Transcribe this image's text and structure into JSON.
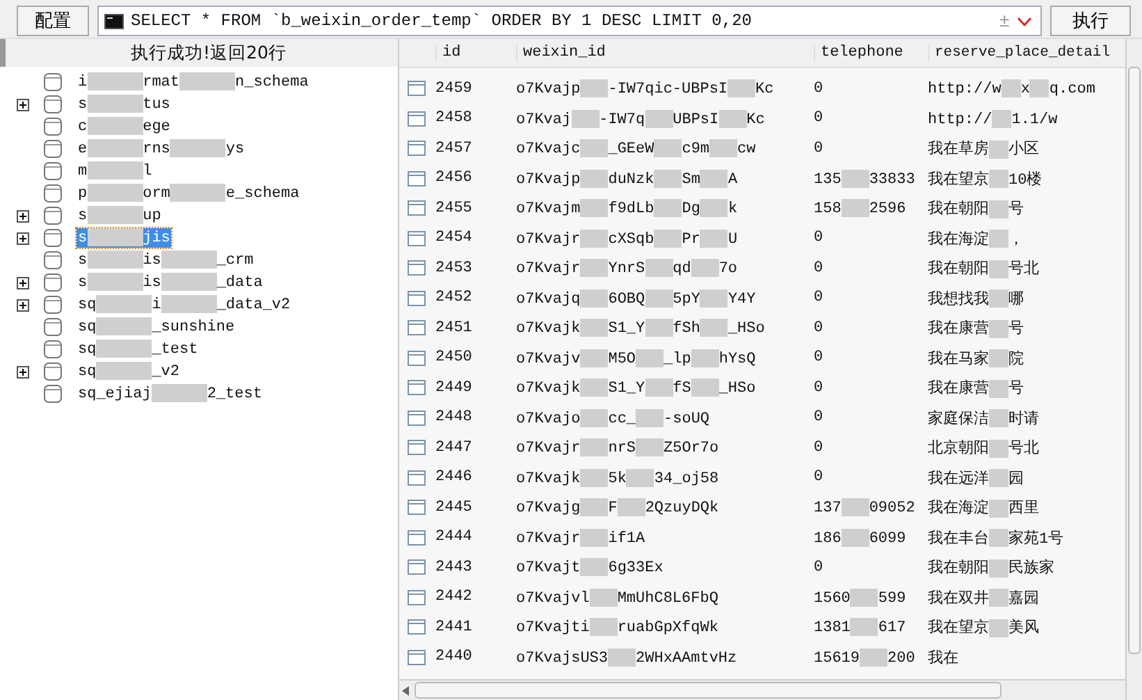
{
  "toolbar": {
    "config_button": "配置",
    "query": "SELECT * FROM `b_weixin_order_temp` ORDER BY 1 DESC LIMIT 0,20",
    "history_toggle": "±",
    "run_button": "执行"
  },
  "status": "执行成功!返回20行",
  "tree": [
    {
      "parts": [
        "i",
        "rmat",
        "n_schema"
      ],
      "expandable": false,
      "selected": false
    },
    {
      "parts": [
        "s",
        "tus"
      ],
      "expandable": true,
      "selected": false
    },
    {
      "parts": [
        "c",
        "ege"
      ],
      "expandable": false,
      "selected": false
    },
    {
      "parts": [
        "e",
        "rns",
        "ys"
      ],
      "expandable": false,
      "selected": false
    },
    {
      "parts": [
        "m",
        "l"
      ],
      "expandable": false,
      "selected": false
    },
    {
      "parts": [
        "p",
        "orm",
        "e_schema"
      ],
      "expandable": false,
      "selected": false
    },
    {
      "parts": [
        "s",
        "up"
      ],
      "expandable": true,
      "selected": false
    },
    {
      "parts": [
        "s",
        "jis"
      ],
      "expandable": true,
      "selected": true
    },
    {
      "parts": [
        "s",
        "is",
        "_crm"
      ],
      "expandable": false,
      "selected": false
    },
    {
      "parts": [
        "s",
        "is",
        "_data"
      ],
      "expandable": true,
      "selected": false
    },
    {
      "parts": [
        "sq",
        "i",
        "_data_v2"
      ],
      "expandable": true,
      "selected": false
    },
    {
      "parts": [
        "sq",
        "_sunshine"
      ],
      "expandable": false,
      "selected": false
    },
    {
      "parts": [
        "sq",
        "_test"
      ],
      "expandable": false,
      "selected": false
    },
    {
      "parts": [
        "sq",
        "_v2"
      ],
      "expandable": true,
      "selected": false
    },
    {
      "parts": [
        "sq_ejiaj",
        "2_test"
      ],
      "expandable": false,
      "selected": false
    }
  ],
  "table": {
    "columns": [
      "id",
      "weixin_id",
      "telephone",
      "reserve_place_detail"
    ],
    "rows": [
      {
        "id": "2459",
        "weixin_id": [
          "o7Kvajp",
          "-IW7qic-UBPsI",
          "Kc"
        ],
        "telephone": [
          "0"
        ],
        "reserve": [
          "http://w",
          "x",
          "q.com"
        ]
      },
      {
        "id": "2458",
        "weixin_id": [
          "o7Kvaj",
          "-IW7q",
          "UBPsI",
          "Kc"
        ],
        "telephone": [
          "0"
        ],
        "reserve": [
          "http://",
          "1.1/w"
        ]
      },
      {
        "id": "2457",
        "weixin_id": [
          "o7Kvajc",
          "_GEeW",
          "c9m",
          "cw"
        ],
        "telephone": [
          "0"
        ],
        "reserve": [
          "我在草房",
          "小区"
        ]
      },
      {
        "id": "2456",
        "weixin_id": [
          "o7Kvajp",
          "duNzk",
          "Sm",
          "A"
        ],
        "telephone": [
          "135",
          "33833"
        ],
        "reserve": [
          "我在望京",
          "10楼"
        ]
      },
      {
        "id": "2455",
        "weixin_id": [
          "o7Kvajm",
          "f9dLb",
          "Dg",
          "k"
        ],
        "telephone": [
          "158",
          "2596"
        ],
        "reserve": [
          "我在朝阳",
          "号"
        ]
      },
      {
        "id": "2454",
        "weixin_id": [
          "o7Kvajr",
          "cXSqb",
          "Pr",
          "U"
        ],
        "telephone": [
          "0"
        ],
        "reserve": [
          "我在海淀",
          "，"
        ]
      },
      {
        "id": "2453",
        "weixin_id": [
          "o7Kvajr",
          "YnrS",
          "qd",
          "7o"
        ],
        "telephone": [
          "0"
        ],
        "reserve": [
          "我在朝阳",
          "号北"
        ]
      },
      {
        "id": "2452",
        "weixin_id": [
          "o7Kvajq",
          "6OBQ",
          "5pY",
          "Y4Y"
        ],
        "telephone": [
          "0"
        ],
        "reserve": [
          "我想找我",
          "哪"
        ]
      },
      {
        "id": "2451",
        "weixin_id": [
          "o7Kvajk",
          "S1_Y",
          "fSh",
          "_HSo"
        ],
        "telephone": [
          "0"
        ],
        "reserve": [
          "我在康营",
          "号"
        ]
      },
      {
        "id": "2450",
        "weixin_id": [
          "o7Kvajv",
          "M5O",
          "_lp",
          "hYsQ"
        ],
        "telephone": [
          "0"
        ],
        "reserve": [
          "我在马家",
          "院"
        ]
      },
      {
        "id": "2449",
        "weixin_id": [
          "o7Kvajk",
          "S1_Y",
          "fS",
          "_HSo"
        ],
        "telephone": [
          "0"
        ],
        "reserve": [
          "我在康营",
          "号"
        ]
      },
      {
        "id": "2448",
        "weixin_id": [
          "o7Kvajo",
          "cc_",
          "-soUQ"
        ],
        "telephone": [
          "0"
        ],
        "reserve": [
          "家庭保洁",
          "时请"
        ]
      },
      {
        "id": "2447",
        "weixin_id": [
          "o7Kvajr",
          "nrS",
          "Z5Or7o"
        ],
        "telephone": [
          "0"
        ],
        "reserve": [
          "北京朝阳",
          "号北"
        ]
      },
      {
        "id": "2446",
        "weixin_id": [
          "o7Kvajk",
          "5k",
          "34_oj58"
        ],
        "telephone": [
          "0"
        ],
        "reserve": [
          "我在远洋",
          "园"
        ]
      },
      {
        "id": "2445",
        "weixin_id": [
          "o7Kvajg",
          "F",
          "2QzuyDQk"
        ],
        "telephone": [
          "137",
          "09052"
        ],
        "reserve": [
          "我在海淀",
          "西里"
        ]
      },
      {
        "id": "2444",
        "weixin_id": [
          "o7Kvajr",
          "if1A"
        ],
        "telephone": [
          "186",
          "6099"
        ],
        "reserve": [
          "我在丰台",
          "家苑1号"
        ]
      },
      {
        "id": "2443",
        "weixin_id": [
          "o7Kvajt",
          "6g33Ex"
        ],
        "telephone": [
          "0"
        ],
        "reserve": [
          "我在朝阳",
          "民族家"
        ]
      },
      {
        "id": "2442",
        "weixin_id": [
          "o7Kvajvl",
          "MmUhC8L6FbQ"
        ],
        "telephone": [
          "1560",
          "599"
        ],
        "reserve": [
          "我在双井",
          "嘉园"
        ]
      },
      {
        "id": "2441",
        "weixin_id": [
          "o7Kvajti",
          "ruabGpXfqWk"
        ],
        "telephone": [
          "1381",
          "617"
        ],
        "reserve": [
          "我在望京",
          "美风"
        ]
      },
      {
        "id": "2440",
        "weixin_id": [
          "o7KvajsUS3",
          "2WHxAAmtvHz"
        ],
        "telephone": [
          "15619",
          "200"
        ],
        "reserve": [
          "我在"
        ]
      }
    ]
  }
}
